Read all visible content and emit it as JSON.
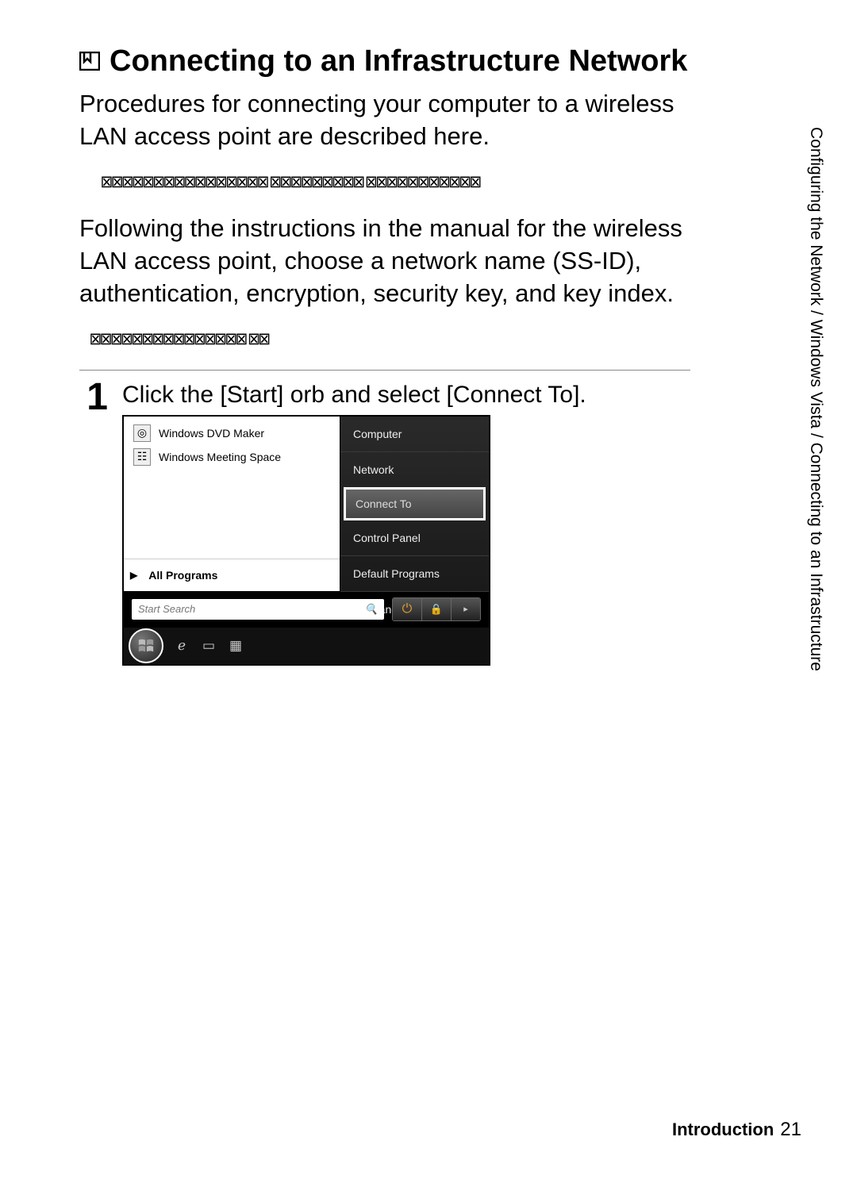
{
  "heading": "Connecting to an Infrastructure Network",
  "intro": "Procedures for connecting your computer to a wireless LAN access point are described here.",
  "placeholder1": "⊠⊠⊠⊠⊠⊠⊠⊠⊠⊠⊠⊠⊠⊠⊠⊠  ⊠⊠⊠⊠⊠⊠⊠⊠⊠  ⊠⊠⊠⊠⊠⊠⊠⊠⊠⊠⊠",
  "para2": "Following the instructions in the manual for the wireless LAN access point, choose a network name (SS-ID), authentication, encryption, security key, and key index.",
  "placeholder2": "⊠⊠⊠⊠⊠⊠⊠⊠⊠⊠⊠⊠⊠⊠⊠ ⊠⊠",
  "step": {
    "num": "1",
    "text": "Click the [Start] orb and select [Connect To]."
  },
  "startmenu": {
    "left": {
      "items": [
        {
          "label": "Windows DVD Maker"
        },
        {
          "label": "Windows Meeting Space"
        }
      ],
      "all_programs": "All Programs"
    },
    "right": {
      "computer": "Computer",
      "network": "Network",
      "connect_to": "Connect To",
      "control_panel": "Control Panel",
      "default_programs": "Default Programs",
      "help": "Help and Support"
    },
    "search_placeholder": "Start Search"
  },
  "power": {
    "shutdown": "⏻",
    "lock": "🔒",
    "arrow": "▸"
  },
  "side_label": "Configuring the Network / Windows Vista / Connecting to an Infrastructure",
  "footer": {
    "section": "Introduction",
    "page": "21"
  }
}
